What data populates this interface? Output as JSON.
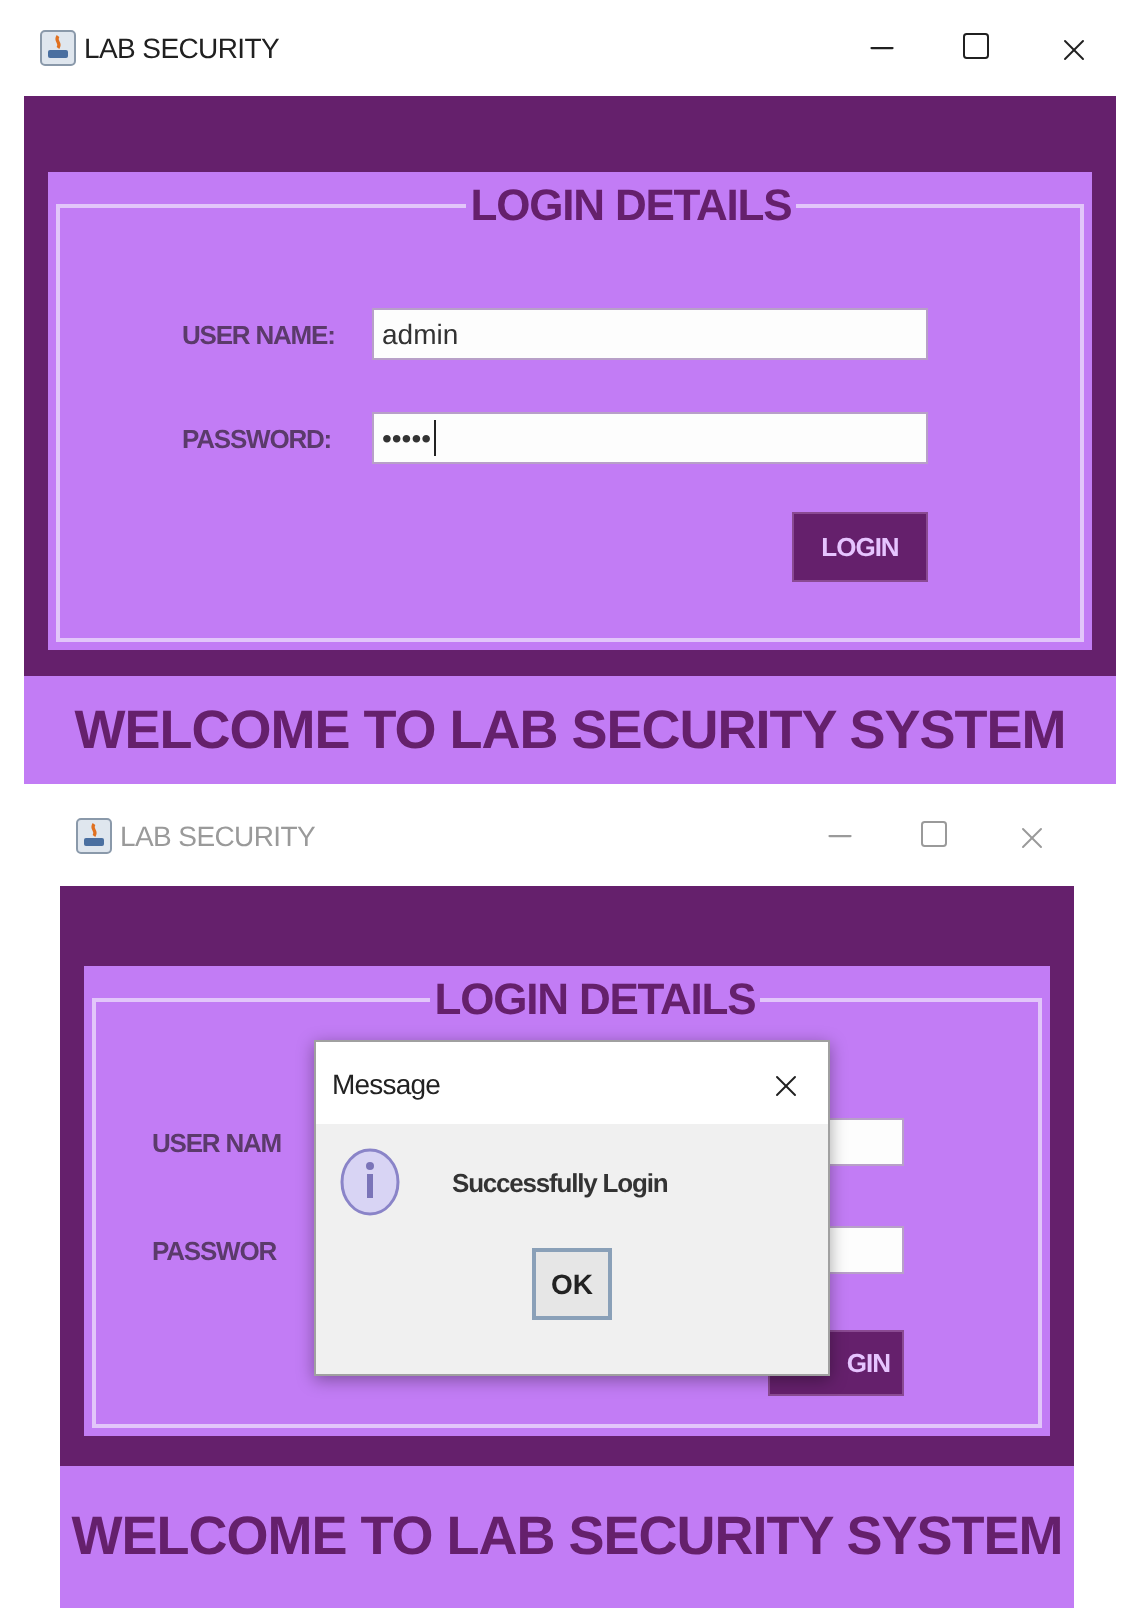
{
  "windows": [
    {
      "title": "LAB SECURITY",
      "active": true,
      "form_title": "LOGIN DETAILS",
      "fields": [
        {
          "label": "USER NAME:",
          "value": "admin",
          "kind": "text"
        },
        {
          "label": "PASSWORD:",
          "value": "•••••",
          "kind": "password"
        }
      ],
      "button": "LOGIN",
      "footer": "WELCOME TO LAB SECURITY SYSTEM"
    },
    {
      "title": "LAB SECURITY",
      "active": false,
      "form_title": "LOGIN DETAILS",
      "fields": [
        {
          "label": "USER NAM",
          "kind": "text"
        },
        {
          "label": "PASSWOR",
          "kind": "password"
        }
      ],
      "button": "GIN",
      "footer": "WELCOME TO LAB SECURITY SYSTEM",
      "dialog": {
        "title": "Message",
        "message": "Successfully Login",
        "button": "OK"
      }
    }
  ]
}
